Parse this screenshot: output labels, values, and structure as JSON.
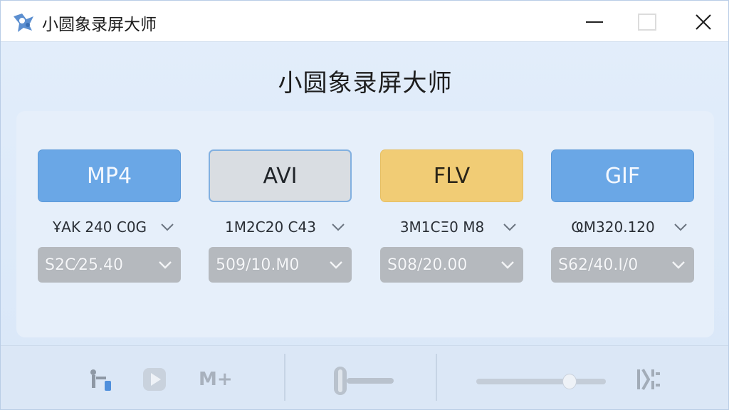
{
  "window": {
    "title": "小圆象录屏大师",
    "icon": "app-logo-icon",
    "controls": [
      "minimize-icon",
      "maximize-icon",
      "close-icon"
    ]
  },
  "heading": "小圆象录屏大师",
  "formats": [
    {
      "label": "MP4",
      "color": "#6aa7e6"
    },
    {
      "label": "AVI",
      "color": "#d9dde2"
    },
    {
      "label": "FLV",
      "color": "#f1cc75"
    },
    {
      "label": "GIF",
      "color": "#6aa7e6"
    }
  ],
  "resolutions": [
    "ҰAK 240 C0G",
    "1M2C20 C43",
    "3M1CΞ0 M8",
    "ҨM320.120"
  ],
  "fps": [
    "S2C⁄25.40",
    "509/10.M0",
    "S08/20.00",
    "S62/40.I/0"
  ],
  "toolbar": {
    "icons": [
      "pin-icon",
      "play-icon",
      "m-plus-icon",
      "volume-slider-icon",
      "progress-slider",
      "effects-icon"
    ],
    "m_plus_label": "M+",
    "slider_level": 0.67
  }
}
